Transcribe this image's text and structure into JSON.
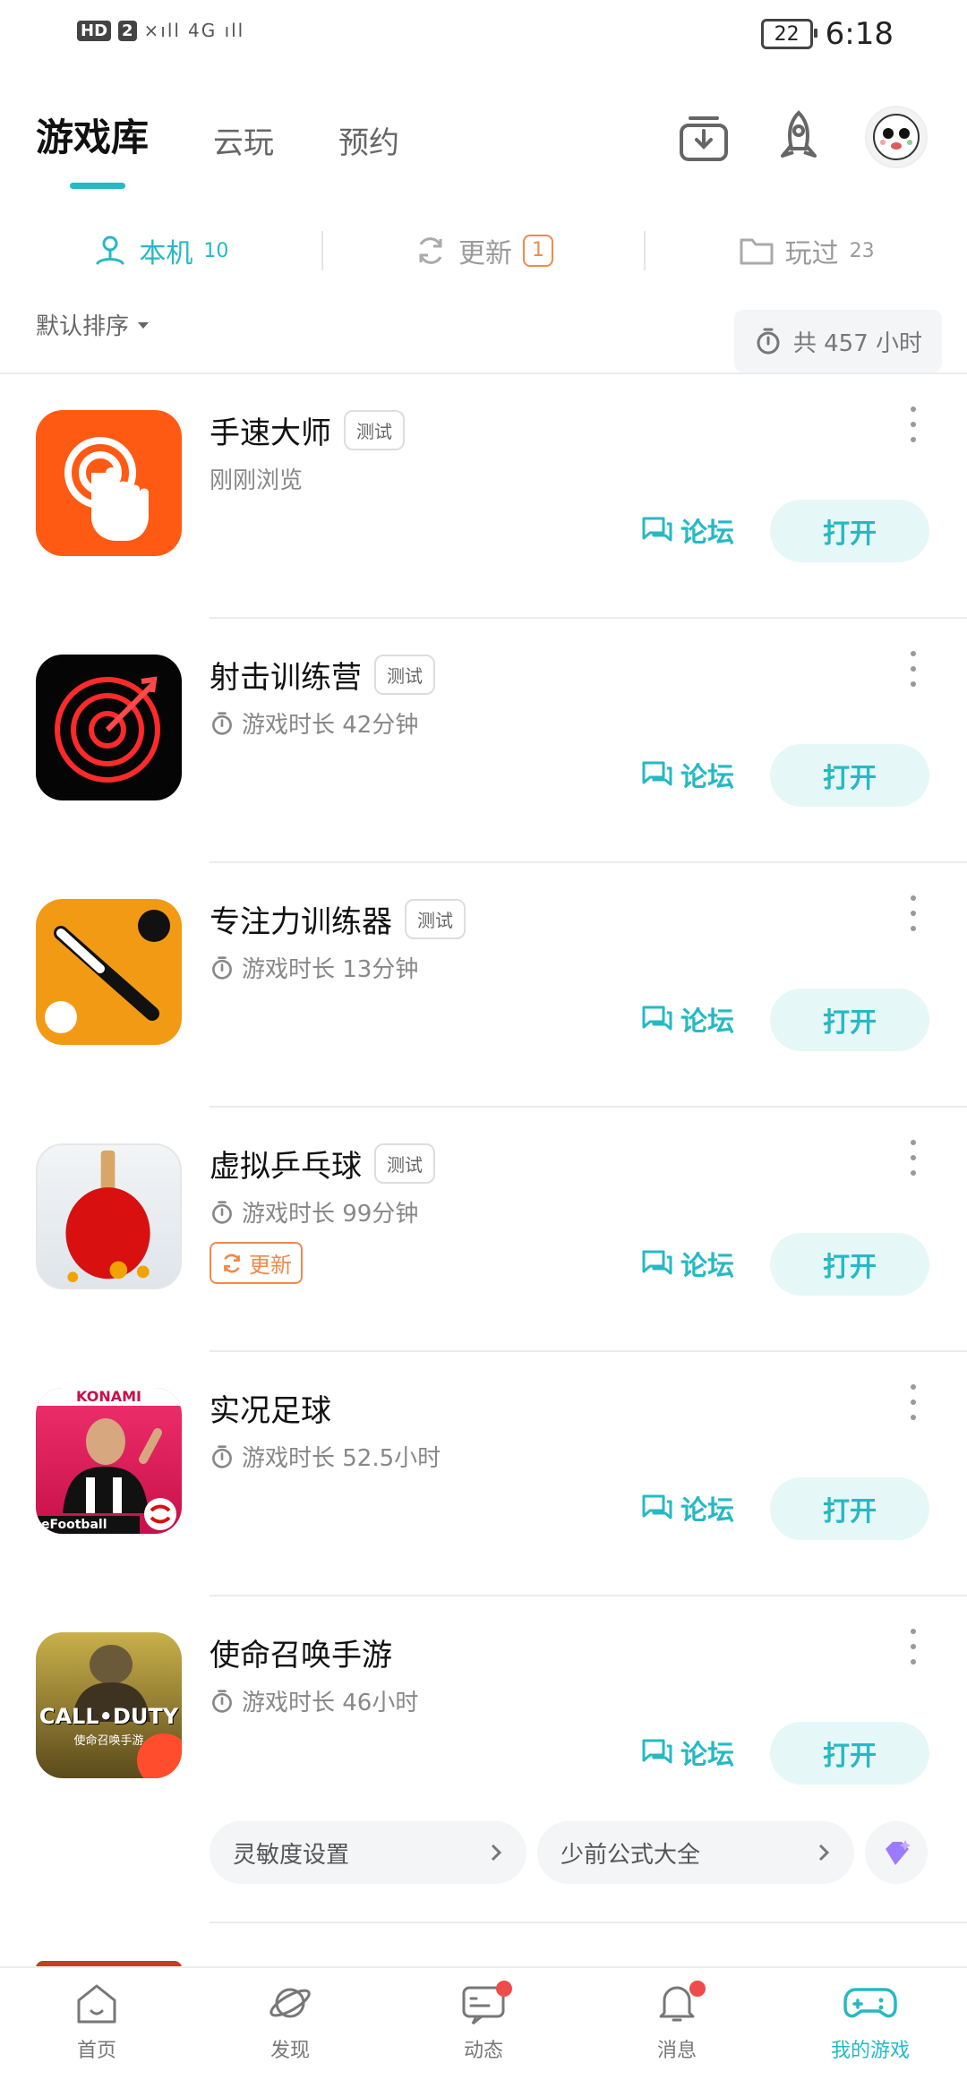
{
  "status_bar": {
    "hd": "HD",
    "sim": "2",
    "signal1": "×ıll",
    "signal2": "4G ıll",
    "battery": "22",
    "time": "6:18"
  },
  "top_tabs": [
    {
      "label": "游戏库"
    },
    {
      "label": "云玩"
    },
    {
      "label": "预约"
    }
  ],
  "sub_tabs": [
    {
      "label": "本机",
      "count": "10"
    },
    {
      "label": "更新",
      "count": "1"
    },
    {
      "label": "玩过",
      "count": "23"
    }
  ],
  "sort": {
    "label": "默认排序"
  },
  "total_time": "共 457 小时",
  "games": [
    {
      "name": "手速大师",
      "tag": "测试",
      "info": "刚刚浏览",
      "forum": "论坛",
      "open": "打开"
    },
    {
      "name": "射击训练营",
      "tag": "测试",
      "info": "游戏时长 42分钟",
      "forum": "论坛",
      "open": "打开"
    },
    {
      "name": "专注力训练器",
      "tag": "测试",
      "info": "游戏时长 13分钟",
      "forum": "论坛",
      "open": "打开"
    },
    {
      "name": "虚拟乒乓球",
      "tag": "测试",
      "info": "游戏时长 99分钟",
      "update": "更新",
      "forum": "论坛",
      "open": "打开"
    },
    {
      "name": "实况足球",
      "info": "游戏时长 52.5小时",
      "forum": "论坛",
      "open": "打开",
      "icon_text": {
        "top": "KONAMI",
        "bottom": "eFootball"
      }
    },
    {
      "name": "使命召唤手游",
      "info": "游戏时长 46小时",
      "forum": "论坛",
      "open": "打开",
      "icon_text": {
        "main": "CALL•DUTY",
        "sub": "使命召唤手游"
      }
    }
  ],
  "chips": [
    {
      "label": "灵敏度设置"
    },
    {
      "label": "少前公式大全"
    }
  ],
  "bottom_nav": [
    {
      "label": "首页"
    },
    {
      "label": "发现"
    },
    {
      "label": "动态"
    },
    {
      "label": "消息"
    },
    {
      "label": "我的游戏"
    }
  ],
  "colors": {
    "accent": "#26b9c4",
    "update": "#f08a4b",
    "badge_dot": "#ee4b4b"
  }
}
